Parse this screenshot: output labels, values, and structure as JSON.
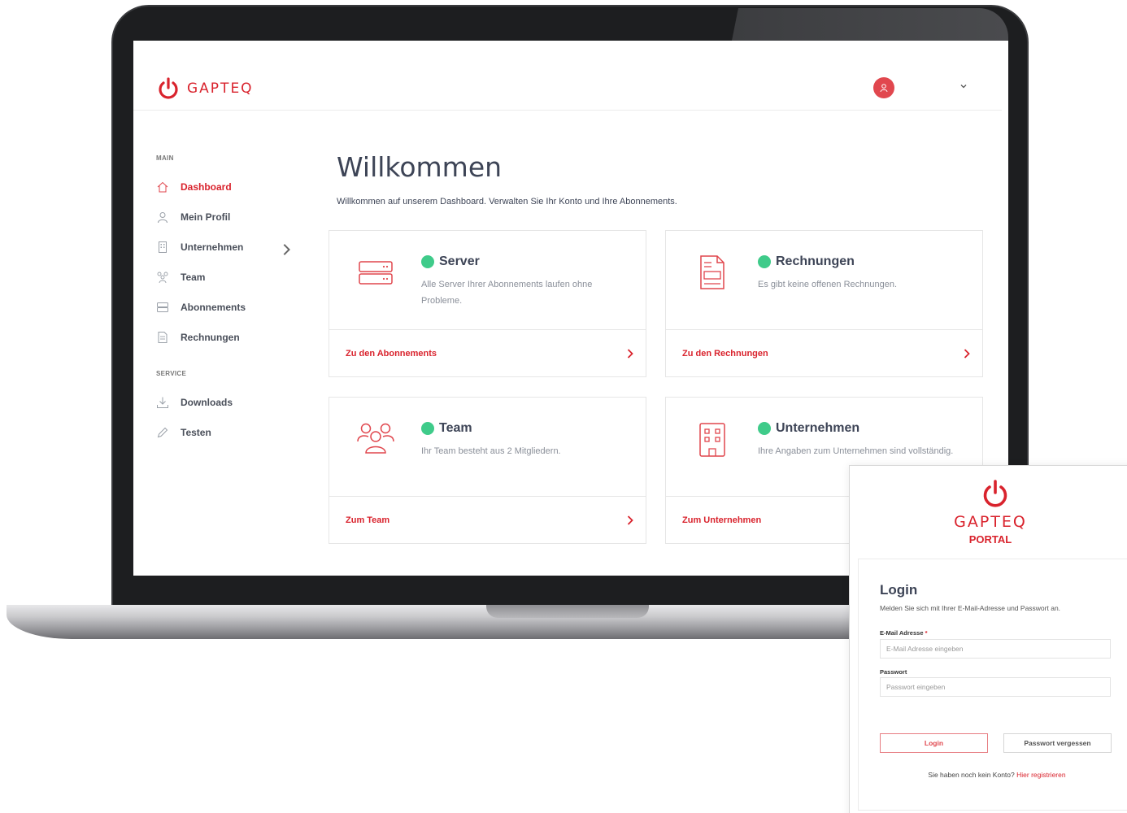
{
  "brand": {
    "name": "GAPTEQ",
    "accent": "#d9232d"
  },
  "sidebar": {
    "main_title": "MAIN",
    "main_items": [
      {
        "label": "Dashboard",
        "icon": "home-icon",
        "active": true
      },
      {
        "label": "Mein Profil",
        "icon": "user-icon"
      },
      {
        "label": "Unternehmen",
        "icon": "building-icon",
        "has_submenu": true
      },
      {
        "label": "Team",
        "icon": "team-icon"
      },
      {
        "label": "Abonnements",
        "icon": "server-icon"
      },
      {
        "label": "Rechnungen",
        "icon": "invoice-icon"
      }
    ],
    "service_title": "SERVICE",
    "service_items": [
      {
        "label": "Downloads",
        "icon": "download-icon"
      },
      {
        "label": "Testen",
        "icon": "pencil-icon"
      }
    ]
  },
  "main": {
    "title": "Willkommen",
    "subtitle": "Willkommen auf unserem Dashboard. Verwalten Sie Ihr Konto und Ihre Abonnements.",
    "cards": [
      {
        "title": "Server",
        "text": "Alle Server Ihrer Abonnements laufen ohne Probleme.",
        "link": "Zu den Abonnements",
        "icon": "server-icon",
        "status_color": "#3fcb8a"
      },
      {
        "title": "Rechnungen",
        "text": "Es gibt keine offenen Rechnungen.",
        "link": "Zu den Rechnungen",
        "icon": "invoice-icon",
        "status_color": "#3fcb8a"
      },
      {
        "title": "Team",
        "text": "Ihr Team besteht aus 2 Mitgliedern.",
        "link": "Zum Team",
        "icon": "team-icon",
        "status_color": "#3fcb8a"
      },
      {
        "title": "Unternehmen",
        "text": "Ihre Angaben zum Unternehmen sind vollständig.",
        "link": "Zum Unternehmen",
        "icon": "building-icon",
        "status_color": "#3fcb8a"
      }
    ]
  },
  "login": {
    "brand": "GAPTEQ",
    "subtitle": "PORTAL",
    "title": "Login",
    "description": "Melden Sie sich mit Ihrer E-Mail-Adresse und Passwort an.",
    "email_label": "E-Mail Adresse",
    "email_required": "*",
    "email_placeholder": "E-Mail Adresse eingeben",
    "password_label": "Passwort",
    "password_placeholder": "Passwort eingeben",
    "login_button": "Login",
    "forgot_button": "Passwort vergessen",
    "register_text": "Sie haben noch kein Konto?",
    "register_link": "Hier registrieren"
  }
}
